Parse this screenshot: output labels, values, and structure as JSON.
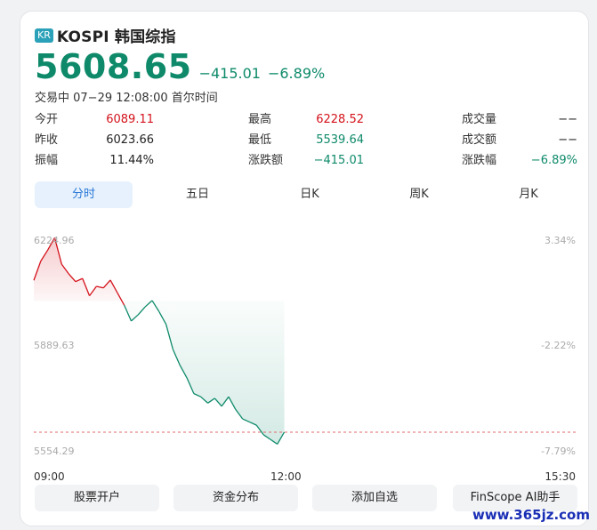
{
  "header": {
    "badge": "KR",
    "index_name": "KOSPI 韩国综指",
    "price": "5608.65",
    "change": "−415.01",
    "change_pct": "−6.89%",
    "status": "交易中 07−29 12:08:00 首尔时间"
  },
  "stats": [
    {
      "label": "今开",
      "value": "6089.11",
      "tone": "red"
    },
    {
      "label": "最高",
      "value": "6228.52",
      "tone": "red"
    },
    {
      "label": "成交量",
      "value": "−−",
      "tone": "dark"
    },
    {
      "label": "昨收",
      "value": "6023.66",
      "tone": "dark"
    },
    {
      "label": "最低",
      "value": "5539.64",
      "tone": "green"
    },
    {
      "label": "成交额",
      "value": "−−",
      "tone": "dark"
    },
    {
      "label": "振幅",
      "value": "11.44%",
      "tone": "dark"
    },
    {
      "label": "涨跌额",
      "value": "−415.01",
      "tone": "green"
    },
    {
      "label": "涨跌幅",
      "value": "−6.89%",
      "tone": "green"
    }
  ],
  "tabs": [
    {
      "label": "分时",
      "active": true
    },
    {
      "label": "五日",
      "active": false
    },
    {
      "label": "日K",
      "active": false
    },
    {
      "label": "周K",
      "active": false
    },
    {
      "label": "月K",
      "active": false
    }
  ],
  "chart_data": {
    "type": "line",
    "y_left_labels": [
      "6224.96",
      "5889.63",
      "5554.29"
    ],
    "y_right_labels": [
      "3.34%",
      "-2.22%",
      "-7.79%"
    ],
    "x_labels": [
      "09:00",
      "12:00",
      "15:30"
    ],
    "ylim": [
      5554.29,
      6224.96
    ],
    "prev_close": 6023.66,
    "up_color": "#d4121b",
    "down_color": "#0e8a6a",
    "x": [
      "09:00",
      "09:05",
      "09:10",
      "09:15",
      "09:20",
      "09:25",
      "09:30",
      "09:35",
      "09:40",
      "09:45",
      "09:50",
      "09:55",
      "10:00",
      "10:05",
      "10:10",
      "10:15",
      "10:20",
      "10:25",
      "10:30",
      "10:35",
      "10:40",
      "10:45",
      "10:50",
      "10:55",
      "11:00",
      "11:05",
      "11:10",
      "11:15",
      "11:20",
      "11:25",
      "11:30",
      "11:35",
      "11:40",
      "11:45",
      "11:50",
      "11:55",
      "12:00"
    ],
    "values": [
      6089,
      6150,
      6185,
      6224,
      6140,
      6110,
      6085,
      6095,
      6040,
      6070,
      6065,
      6090,
      6050,
      6010,
      5960,
      5980,
      6005,
      6025,
      5990,
      5950,
      5870,
      5820,
      5780,
      5730,
      5720,
      5700,
      5715,
      5690,
      5720,
      5680,
      5650,
      5640,
      5630,
      5600,
      5585,
      5570,
      5608
    ]
  },
  "buttons": [
    "股票开户",
    "资金分布",
    "添加自选",
    "FinScope AI助手"
  ],
  "watermark": "www.365jz.com"
}
